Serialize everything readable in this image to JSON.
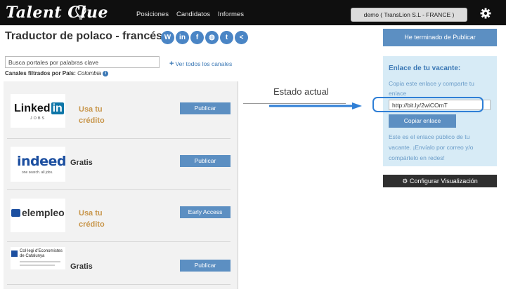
{
  "topbar": {
    "logo_text": "Talent Clue",
    "logo_icon": "lightbulb-icon",
    "nav": [
      "Posiciones",
      "Candidatos",
      "Informes"
    ],
    "account": "demo ( TransLion S.L - FRANCE )",
    "settings_icon": "gear-icon"
  },
  "page": {
    "title": "Traductor de polaco - francés",
    "share_icons": [
      {
        "name": "wordpress-icon",
        "glyph": "W"
      },
      {
        "name": "linkedin-icon",
        "glyph": "in"
      },
      {
        "name": "facebook-icon",
        "glyph": "f"
      },
      {
        "name": "globe-icon",
        "glyph": "◍"
      },
      {
        "name": "twitter-icon",
        "glyph": "t"
      },
      {
        "name": "share-icon",
        "glyph": "<"
      }
    ]
  },
  "search": {
    "placeholder": "Busca portales por palabras clave",
    "see_all": "Ver todos los canales",
    "filter_label": "Canales filtrados por País:",
    "filter_value": "Colombia"
  },
  "channels": [
    {
      "logo": "linkedin-jobs-logo",
      "logo_main": "Linked",
      "logo_in": "in",
      "logo_sub": "JOBS",
      "price_line1": "Usa tu",
      "price_line2": "crédito",
      "price_type": "credit",
      "button": "Publicar"
    },
    {
      "logo": "indeed-logo",
      "logo_main": "indeed",
      "logo_sub": "one search. all jobs.",
      "price_line1": "Gratis",
      "price_line2": "",
      "price_type": "free",
      "button": "Publicar"
    },
    {
      "logo": "elempleo-logo",
      "logo_main": "elempleo",
      "price_line1": "Usa tu",
      "price_line2": "crédito",
      "price_type": "credit",
      "button": "Early Access"
    },
    {
      "logo": "col-legi-economistes-logo",
      "logo_line1": "Col·legi d'Economistes",
      "logo_line2": "de Catalunya",
      "price_line1": "Gratis",
      "price_line2": "",
      "price_type": "free",
      "button": "Publicar"
    }
  ],
  "estado": {
    "title": "Estado actual"
  },
  "sidebar": {
    "finish_button": "He terminado de Publicar",
    "link_title": "Enlace de tu vacante:",
    "link_desc": "Copia este enlace y comparte tu enlace",
    "link_value": "http://bit.ly/2wiCOmT",
    "copy_button": "Copiar enlace",
    "link_note": "Este es el enlace público de tu vacante. ¡Envíalo por correo y/o compártelo en redes!",
    "config_button": "Configurar Visualización",
    "config_icon": "gear-icon"
  },
  "colors": {
    "topbar": "#0f0f0f",
    "accent": "#5c8fc2",
    "credit": "#c8964b",
    "link_panel": "#d7ebf6",
    "highlight": "#2f7fd6"
  }
}
